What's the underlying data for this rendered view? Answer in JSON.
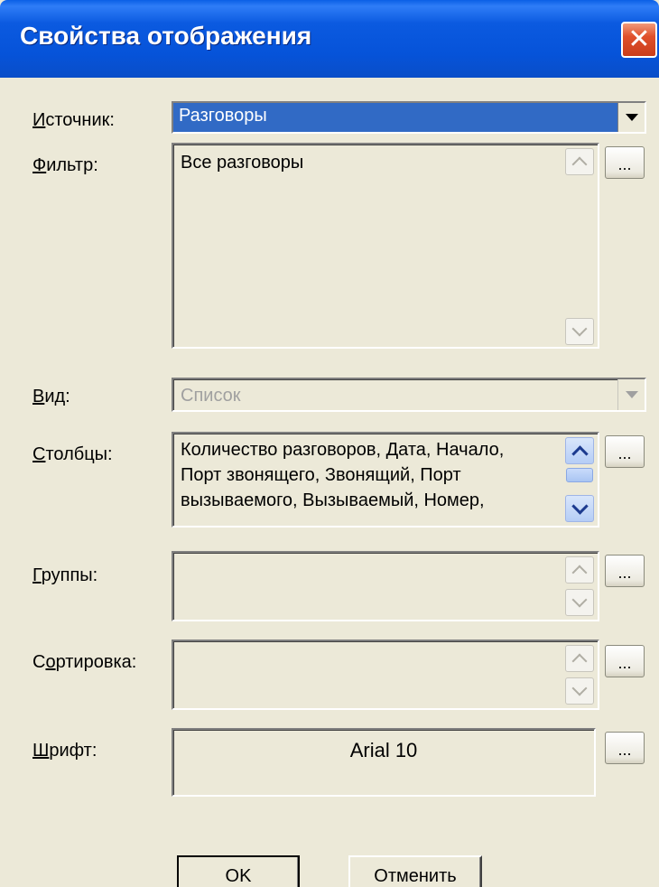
{
  "window": {
    "title": "Свойства отображения",
    "close_label": "✕"
  },
  "source": {
    "label_underline": "И",
    "label_rest": "сточник:",
    "value": "Разговоры"
  },
  "filter": {
    "label_underline": "Ф",
    "label_rest": "ильтр:",
    "value": "Все разговоры",
    "button_label": "..."
  },
  "view": {
    "label_underline": "В",
    "label_rest": "ид:",
    "value": "Список"
  },
  "columns": {
    "label_underline": "С",
    "label_rest": "толбцы:",
    "lines": [
      "Количество разговоров, Дата, Начало,",
      "Порт звонящего, Звонящий, Порт",
      "вызываемого, Вызываемый, Номер,"
    ],
    "button_label": "..."
  },
  "groups": {
    "label_underline": "Г",
    "label_rest": "руппы:",
    "value": "",
    "button_label": "..."
  },
  "sort": {
    "label_pre": "С",
    "label_underline": "о",
    "label_rest": "ртировка:",
    "value": "",
    "button_label": "..."
  },
  "font": {
    "label_underline": "Ш",
    "label_rest": "рифт:",
    "value": "Arial 10",
    "button_label": "..."
  },
  "buttons": {
    "ok_label": "OK",
    "cancel_label": "Отменить"
  }
}
